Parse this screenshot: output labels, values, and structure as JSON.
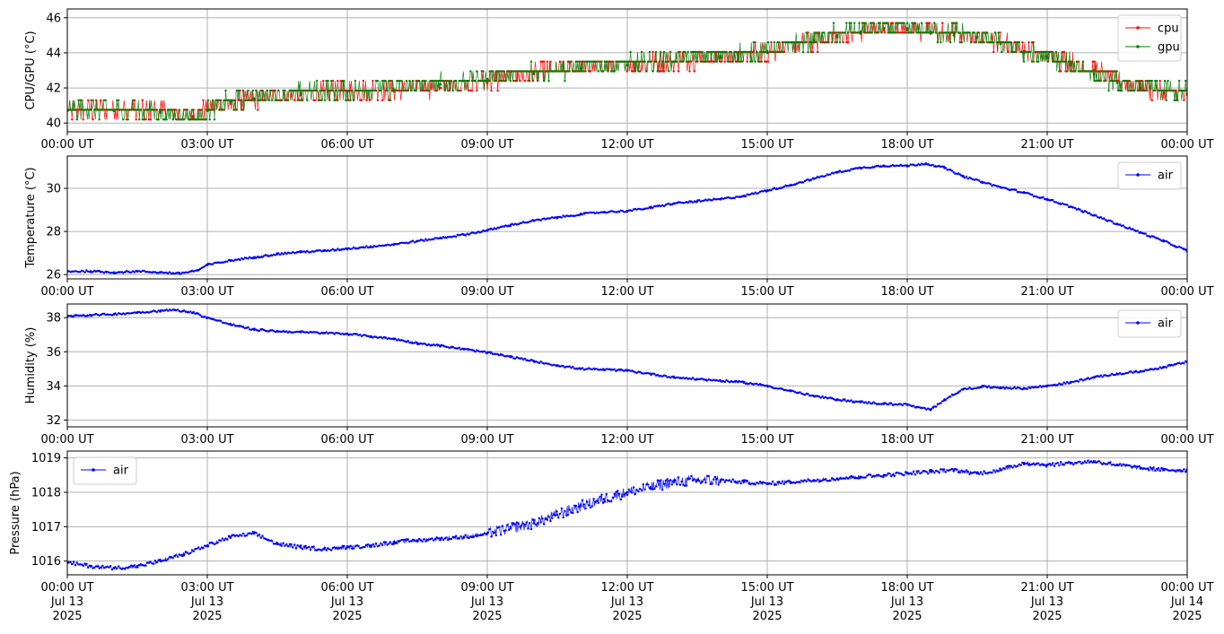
{
  "chart_data": [
    {
      "type": "line",
      "ylabel": "CPU/GPU (°C)",
      "ylim": [
        39.5,
        46.5
      ],
      "yticks": [
        40,
        42,
        44,
        46
      ],
      "xlim": [
        0,
        24
      ],
      "xticks": [
        0,
        3,
        6,
        9,
        12,
        15,
        18,
        21,
        24
      ],
      "xtick_labels": [
        "00:00 UT",
        "03:00 UT",
        "06:00 UT",
        "09:00 UT",
        "12:00 UT",
        "15:00 UT",
        "18:00 UT",
        "21:00 UT",
        "00:00 UT"
      ],
      "grid": true,
      "legend_position": "top-right",
      "series": [
        {
          "name": "cpu",
          "color": "#ff0000",
          "x": [
            0,
            1,
            2,
            2.7,
            3,
            3.5,
            4,
            5,
            6,
            7,
            8,
            9,
            10,
            11,
            12,
            13,
            14,
            15,
            16,
            16.5,
            17,
            17.5,
            18,
            18.5,
            19,
            19.5,
            20,
            20.5,
            21,
            21.5,
            22,
            22.5,
            23,
            23.5,
            24
          ],
          "y": [
            40.7,
            40.7,
            40.7,
            40.4,
            40.7,
            41.1,
            41.3,
            41.6,
            41.8,
            41.8,
            42.0,
            42.3,
            42.8,
            43.1,
            43.3,
            43.5,
            43.7,
            44.0,
            44.6,
            44.9,
            45.1,
            45.3,
            45.3,
            45.1,
            45.0,
            44.9,
            44.6,
            44.1,
            43.8,
            43.4,
            43.0,
            42.4,
            42.0,
            41.7,
            41.6
          ]
        },
        {
          "name": "gpu",
          "color": "#008000",
          "x": [
            0,
            1,
            2,
            2.7,
            3,
            3.5,
            4,
            5,
            6,
            7,
            8,
            9,
            10,
            11,
            12,
            13,
            14,
            15,
            16,
            16.5,
            17,
            17.5,
            18,
            18.5,
            19,
            19.5,
            20,
            20.5,
            21,
            21.5,
            22,
            22.5,
            23,
            23.5,
            24
          ],
          "y": [
            40.7,
            40.7,
            40.6,
            40.3,
            40.7,
            41.2,
            41.4,
            41.7,
            41.8,
            41.9,
            42.2,
            42.5,
            42.9,
            43.1,
            43.3,
            43.5,
            43.8,
            44.1,
            44.7,
            45.0,
            45.2,
            45.4,
            45.4,
            45.2,
            45.1,
            44.9,
            44.5,
            44.0,
            43.7,
            43.3,
            42.8,
            42.3,
            41.9,
            41.8,
            41.7
          ]
        }
      ]
    },
    {
      "type": "line",
      "ylabel": "Temperature (°C)",
      "ylim": [
        25.8,
        31.5
      ],
      "yticks": [
        26,
        28,
        30
      ],
      "xlim": [
        0,
        24
      ],
      "xticks": [
        0,
        3,
        6,
        9,
        12,
        15,
        18,
        21,
        24
      ],
      "xtick_labels": [
        "00:00 UT",
        "03:00 UT",
        "06:00 UT",
        "09:00 UT",
        "12:00 UT",
        "15:00 UT",
        "18:00 UT",
        "21:00 UT",
        "00:00 UT"
      ],
      "grid": true,
      "legend_position": "top-right",
      "series": [
        {
          "name": "air",
          "color": "#0000ff",
          "x": [
            0,
            0.5,
            1,
            1.5,
            2,
            2.4,
            2.8,
            3,
            3.5,
            4,
            4.5,
            5,
            5.5,
            6,
            6.5,
            7,
            7.5,
            8,
            8.5,
            9,
            9.5,
            10,
            10.5,
            11,
            11.5,
            12,
            12.5,
            13,
            13.5,
            14,
            14.5,
            15,
            15.5,
            16,
            16.5,
            17,
            17.5,
            18,
            18.4,
            18.8,
            19.2,
            19.6,
            20,
            20.5,
            21,
            21.5,
            22,
            22.5,
            23,
            23.5,
            24
          ],
          "y": [
            26.15,
            26.15,
            26.1,
            26.15,
            26.1,
            26.05,
            26.2,
            26.45,
            26.65,
            26.8,
            26.95,
            27.05,
            27.1,
            27.2,
            27.3,
            27.4,
            27.55,
            27.7,
            27.85,
            28.05,
            28.3,
            28.5,
            28.65,
            28.8,
            28.9,
            28.95,
            29.1,
            29.3,
            29.4,
            29.5,
            29.65,
            29.9,
            30.15,
            30.45,
            30.75,
            30.95,
            31.05,
            31.05,
            31.15,
            30.95,
            30.55,
            30.3,
            30.05,
            29.8,
            29.5,
            29.15,
            28.75,
            28.35,
            27.95,
            27.55,
            27.1
          ]
        }
      ]
    },
    {
      "type": "line",
      "ylabel": "Humidity (%)",
      "ylim": [
        31.6,
        38.8
      ],
      "yticks": [
        32,
        34,
        36,
        38
      ],
      "xlim": [
        0,
        24
      ],
      "xticks": [
        0,
        3,
        6,
        9,
        12,
        15,
        18,
        21,
        24
      ],
      "xtick_labels": [
        "00:00 UT",
        "03:00 UT",
        "06:00 UT",
        "09:00 UT",
        "12:00 UT",
        "15:00 UT",
        "18:00 UT",
        "21:00 UT",
        "00:00 UT"
      ],
      "grid": true,
      "legend_position": "top-right",
      "series": [
        {
          "name": "air",
          "color": "#0000ff",
          "x": [
            0,
            0.5,
            1,
            1.5,
            2,
            2.3,
            2.7,
            3,
            3.5,
            4,
            4.5,
            5,
            5.5,
            6,
            6.5,
            7,
            7.5,
            8,
            8.5,
            9,
            9.5,
            10,
            10.5,
            11,
            11.5,
            12,
            12.5,
            13,
            13.5,
            14,
            14.5,
            15,
            15.5,
            16,
            16.5,
            17,
            17.5,
            18,
            18.2,
            18.5,
            18.8,
            19.2,
            19.6,
            20,
            20.5,
            21,
            21.5,
            22,
            22.5,
            23,
            23.5,
            24
          ],
          "y": [
            38.1,
            38.15,
            38.2,
            38.3,
            38.4,
            38.45,
            38.3,
            38.0,
            37.6,
            37.3,
            37.2,
            37.15,
            37.1,
            37.05,
            36.9,
            36.75,
            36.5,
            36.35,
            36.15,
            35.95,
            35.7,
            35.45,
            35.2,
            35.0,
            34.95,
            34.9,
            34.7,
            34.5,
            34.4,
            34.3,
            34.2,
            34.0,
            33.7,
            33.4,
            33.2,
            33.05,
            32.95,
            32.9,
            32.75,
            32.6,
            33.2,
            33.8,
            33.95,
            33.9,
            33.85,
            34.0,
            34.2,
            34.5,
            34.7,
            34.85,
            35.1,
            35.4
          ]
        }
      ]
    },
    {
      "type": "line",
      "ylabel": "Pressure (hPa)",
      "ylim": [
        1015.6,
        1019.2
      ],
      "yticks": [
        1016,
        1017,
        1018,
        1019
      ],
      "xlim": [
        0,
        24
      ],
      "xticks": [
        0,
        3,
        6,
        9,
        12,
        15,
        18,
        21,
        24
      ],
      "xtick_labels": [
        "00:00 UT\nJul 13\n2025",
        "03:00 UT\nJul 13\n2025",
        "06:00 UT\nJul 13\n2025",
        "09:00 UT\nJul 13\n2025",
        "12:00 UT\nJul 13\n2025",
        "15:00 UT\nJul 13\n2025",
        "18:00 UT\nJul 13\n2025",
        "21:00 UT\nJul 13\n2025",
        "00:00 UT\nJul 14\n2025"
      ],
      "grid": true,
      "legend_position": "top-left",
      "series": [
        {
          "name": "air",
          "color": "#0000ff",
          "x": [
            0,
            0.5,
            1,
            1.5,
            2,
            2.5,
            3,
            3.5,
            4,
            4.5,
            5,
            5.5,
            6,
            6.5,
            7,
            7.5,
            8,
            8.5,
            9,
            9.5,
            10,
            10.5,
            11,
            11.5,
            12,
            12.5,
            13,
            13.5,
            14,
            14.5,
            15,
            15.5,
            16,
            16.5,
            17,
            17.5,
            18,
            18.5,
            19,
            19.5,
            20,
            20.5,
            21,
            21.5,
            22,
            22.5,
            23,
            23.5,
            24
          ],
          "y": [
            1015.95,
            1015.85,
            1015.8,
            1015.85,
            1016.0,
            1016.2,
            1016.45,
            1016.7,
            1016.8,
            1016.5,
            1016.4,
            1016.35,
            1016.4,
            1016.45,
            1016.55,
            1016.6,
            1016.65,
            1016.7,
            1016.8,
            1016.95,
            1017.1,
            1017.35,
            1017.6,
            1017.8,
            1018.0,
            1018.15,
            1018.3,
            1018.35,
            1018.35,
            1018.3,
            1018.25,
            1018.3,
            1018.35,
            1018.4,
            1018.45,
            1018.5,
            1018.55,
            1018.6,
            1018.65,
            1018.55,
            1018.65,
            1018.85,
            1018.8,
            1018.85,
            1018.9,
            1018.8,
            1018.7,
            1018.65,
            1018.65
          ]
        }
      ]
    }
  ]
}
